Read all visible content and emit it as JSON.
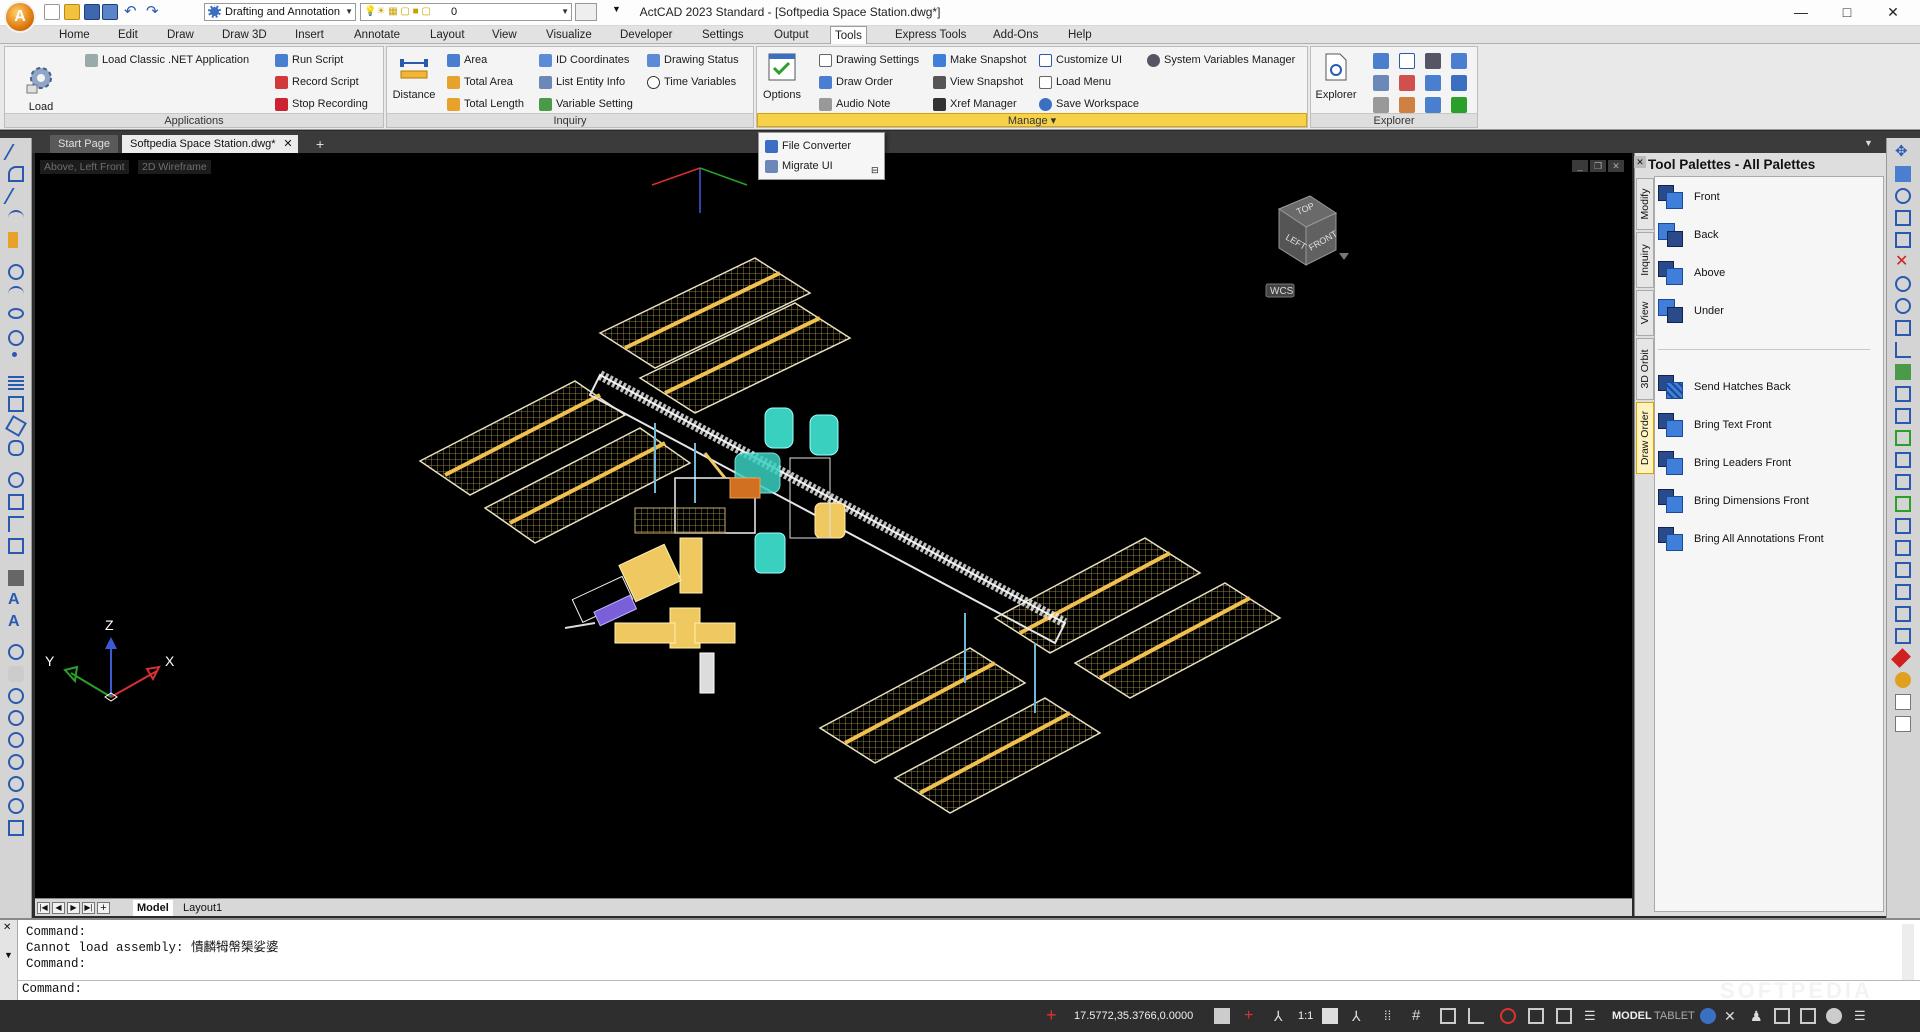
{
  "window": {
    "title": "ActCAD 2023 Standard - [Softpedia Space Station.dwg*]",
    "minimize": "—",
    "maximize": "□",
    "close": "✕"
  },
  "app_logo": "A",
  "quick_access": {
    "workspace": "Drafting and Annotation",
    "layer": "0"
  },
  "ribbon_tabs": [
    "Home",
    "Edit",
    "Draw",
    "Draw 3D",
    "Insert",
    "Annotate",
    "Layout",
    "View",
    "Visualize",
    "Developer",
    "Settings",
    "Output",
    "Tools",
    "Express Tools",
    "Add-Ons",
    "Help"
  ],
  "active_tab": "Tools",
  "ribbon": {
    "applications": {
      "title": "Applications",
      "load_application": "Load\nApplication",
      "load_classic": "Load Classic .NET Application",
      "run_script": "Run Script",
      "record_script": "Record Script",
      "stop_recording": "Stop Recording"
    },
    "inquiry": {
      "title": "Inquiry",
      "distance": "Distance",
      "area": "Area",
      "total_area": "Total Area",
      "total_length": "Total Length",
      "id_coordinates": "ID Coordinates",
      "list_entity_info": "List Entity Info",
      "variable_setting": "Variable Setting",
      "drawing_status": "Drawing Status",
      "time_variables": "Time Variables"
    },
    "manage": {
      "title": "Manage ▾",
      "options": "Options",
      "drawing_settings": "Drawing Settings",
      "draw_order": "Draw Order",
      "audio_note": "Audio Note",
      "make_snapshot": "Make Snapshot",
      "view_snapshot": "View Snapshot",
      "xref_manager": "Xref Manager",
      "customize_ui": "Customize UI",
      "load_menu": "Load Menu",
      "save_workspace": "Save Workspace",
      "system_variables_manager": "System Variables Manager"
    },
    "explorer": {
      "title": "Explorer",
      "explorer": "Explorer"
    }
  },
  "manage_dropdown": [
    "File Converter",
    "Migrate UI"
  ],
  "doc_tabs": [
    "Start Page",
    "Softpedia Space Station.dwg*"
  ],
  "doc_tab_close": "✕",
  "doc_tab_add": "+",
  "viewport": {
    "view_label": "Above, Left Front",
    "style_label": "2D Wireframe",
    "viewcube": {
      "top": "TOP",
      "left": "LEFT",
      "front": "FRONT"
    },
    "wcs": "WCS",
    "ucs": {
      "x": "X",
      "y": "Y",
      "z": "Z"
    }
  },
  "layout_tabs": [
    "Model",
    "Layout1"
  ],
  "palette": {
    "title": "Tool Palettes - All Palettes",
    "tabs": [
      "Modify",
      "Inquiry",
      "View",
      "3D Orbit",
      "Draw Order"
    ],
    "items": [
      "Front",
      "Back",
      "Above",
      "Under",
      "Send Hatches Back",
      "Bring Text Front",
      "Bring Leaders Front",
      "Bring Dimensions Front",
      "Bring All Annotations Front"
    ]
  },
  "command": {
    "lines": [
      "Command:",
      "Cannot load assembly: 憒麟牳幋榘娑婆",
      "Command:"
    ],
    "prompt": "Command:"
  },
  "status": {
    "coords": "17.5772,35.3766,0.0000",
    "scale": "1:1",
    "model": "MODEL",
    "tablet": "TABLET"
  },
  "watermark": "SOFTPEDIA"
}
